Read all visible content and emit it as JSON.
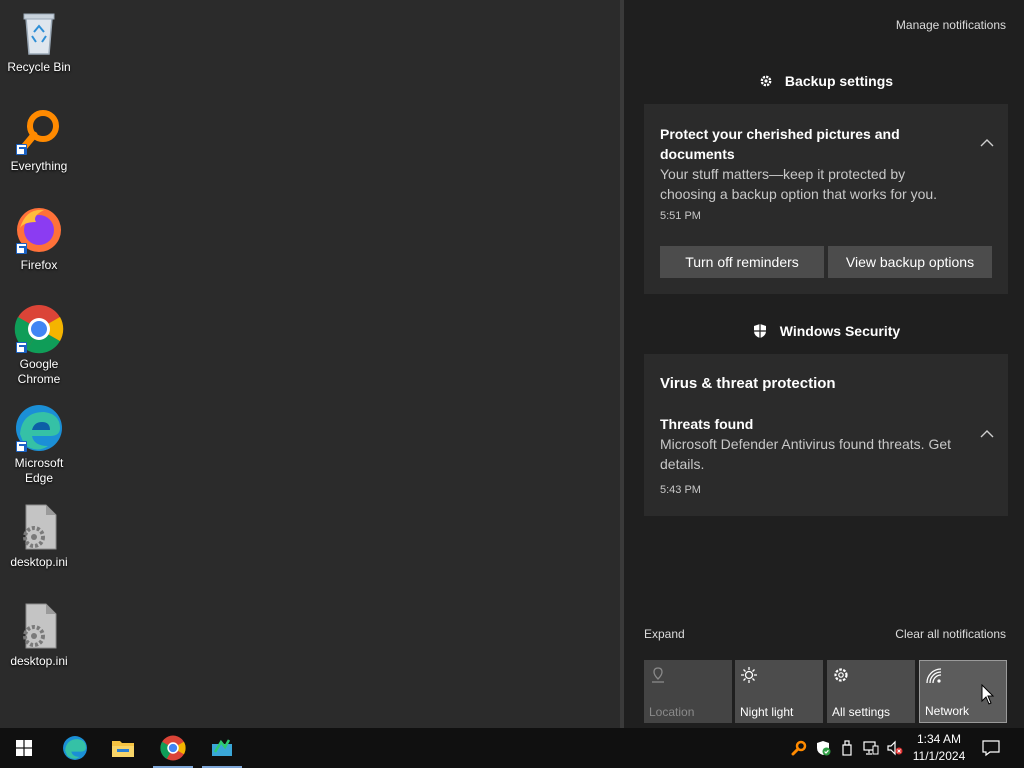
{
  "desktop": {
    "icons": [
      {
        "label": "Recycle Bin",
        "icon": "recycle-bin-icon"
      },
      {
        "label": "Everything",
        "icon": "everything-search-icon"
      },
      {
        "label": "Firefox",
        "icon": "firefox-icon"
      },
      {
        "label": "Google Chrome",
        "icon": "chrome-icon"
      },
      {
        "label": "Microsoft Edge",
        "icon": "edge-icon"
      },
      {
        "label": "desktop.ini",
        "icon": "settings-file-icon"
      },
      {
        "label": "desktop.ini",
        "icon": "settings-file-icon"
      }
    ]
  },
  "action_center": {
    "manage_notifications": "Manage notifications",
    "groups": [
      {
        "name": "Backup settings",
        "icon": "gear-icon",
        "notification": {
          "title": "Protect your cherished pictures and documents",
          "body": "Your stuff matters—keep it protected by choosing a backup option that works for you.",
          "time": "5:51 PM",
          "buttons": [
            "Turn off reminders",
            "View backup options"
          ]
        }
      },
      {
        "name": "Windows Security",
        "icon": "shield-icon",
        "notification": {
          "header": "Virus & threat protection",
          "title": "Threats found",
          "body": "Microsoft Defender Antivirus found threats. Get details.",
          "time": "5:43 PM"
        }
      }
    ],
    "expand": "Expand",
    "clear_all": "Clear all notifications",
    "quick_actions": [
      {
        "label": "Location",
        "icon": "location-icon",
        "state": "disabled"
      },
      {
        "label": "Night light",
        "icon": "night-light-icon",
        "state": "off"
      },
      {
        "label": "All settings",
        "icon": "gear-icon",
        "state": "off"
      },
      {
        "label": "Network",
        "icon": "network-icon",
        "state": "selected"
      }
    ]
  },
  "taskbar": {
    "apps": [
      "start-button",
      "edge-icon",
      "file-explorer-icon",
      "chrome-icon",
      "app-icon"
    ],
    "tray": [
      "everything-icon",
      "windows-security-icon",
      "usb-device-icon",
      "network-icon",
      "volume-muted-icon"
    ],
    "clock": {
      "time": "1:34 AM",
      "date": "11/1/2024"
    },
    "colors": {
      "accent": "#7fa7d8",
      "background": "#101010"
    }
  }
}
